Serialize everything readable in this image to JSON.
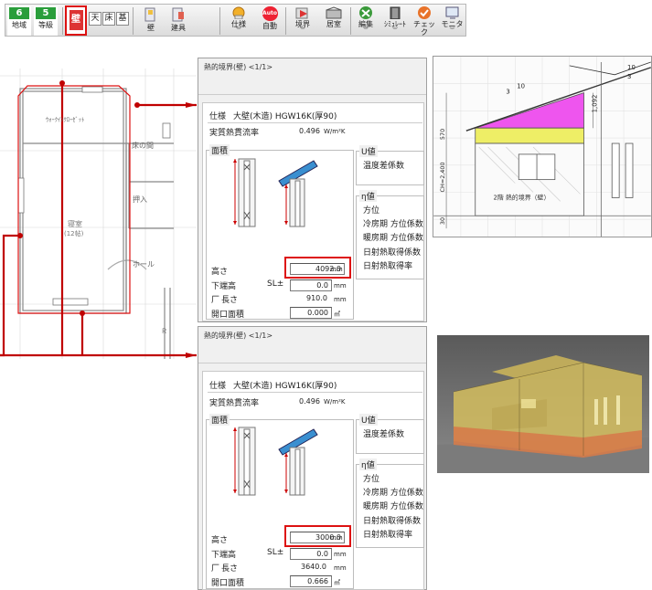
{
  "toolbar": {
    "chiiki": {
      "num": "6",
      "label": "地域"
    },
    "toukyu": {
      "num": "5",
      "label": "等級"
    },
    "kabe_active": "壁",
    "kind_buttons": [
      "天",
      "床",
      "基"
    ],
    "wall_label": "壁",
    "fitting_label": "建具",
    "spec_label": "仕様",
    "auto_icon_text": "Auto",
    "auto_label": "自動",
    "boundary_label": "境界",
    "room_label": "居室",
    "edit_label": "編集",
    "simulate_label": "ｼﾐｭﾚｰﾄ",
    "check_label": "チェック",
    "monitor_label": "モニタ"
  },
  "plan": {
    "walkin_closet": "ｳｫｰｸｲﾝｸﾛｰｾﾞｯﾄ",
    "toko": "床の間",
    "oshiire": "押入",
    "bedroom": "寝室",
    "bedroom_size": "(12帖)",
    "hall": "ホール",
    "stair_mark": "Ｒ"
  },
  "dialog1": {
    "title": "熱的境界(壁)",
    "page": "<1/1>",
    "spec_label": "仕様",
    "spec_value": "大壁(木造) HGW16K(厚90)",
    "flux_label": "実質熱貫流率",
    "flux_value": "0.496",
    "flux_unit": "W/m²K",
    "area_group": "面積",
    "height_label": "高さ",
    "height_value": "4092.0",
    "height_unit": "mm",
    "lower_label": "下端高",
    "lower_prefix": "SL±",
    "lower_value": "0.0",
    "lower_unit": "mm",
    "length_check": "厂",
    "length_label": "長さ",
    "length_value": "910.0",
    "length_unit": "mm",
    "opening_label": "開口面積",
    "opening_value": "0.000",
    "opening_unit": "㎡",
    "u_group": "U値",
    "temp_coef": "温度差係数",
    "eta_group": "η値",
    "direction": "方位",
    "cool_dir": "冷房期 方位係数",
    "heat_dir": "暖房期 方位係数",
    "solar_coef": "日射熱取得係数",
    "solar_rate": "日射熱取得率"
  },
  "dialog2": {
    "title": "熱的境界(壁)",
    "page": "<1/1>",
    "spec_label": "仕様",
    "spec_value": "大壁(木造) HGW16K(厚90)",
    "flux_label": "実質熱貫流率",
    "flux_value": "0.496",
    "flux_unit": "W/m²K",
    "area_group": "面積",
    "height_label": "高さ",
    "height_value": "3000.0",
    "height_unit": "mm",
    "lower_label": "下端高",
    "lower_prefix": "SL±",
    "lower_value": "0.0",
    "lower_unit": "mm",
    "length_check": "厂",
    "length_label": "長さ",
    "length_value": "3640.0",
    "length_unit": "mm",
    "opening_label": "開口面積",
    "opening_value": "0.666",
    "opening_unit": "㎡",
    "u_group": "U値",
    "temp_coef": "温度差係数",
    "eta_group": "η値",
    "direction": "方位",
    "cool_dir": "冷房期 方位係数",
    "heat_dir": "暖房期 方位係数",
    "solar_coef": "日射熱取得係数",
    "solar_rate": "日射熱取得率"
  },
  "elevation": {
    "slope1_num": "10",
    "slope1_den": "3",
    "slope2_num": "10",
    "slope2_den": "3",
    "dim_top": "1,092",
    "dim_570": "570",
    "dim_ch": "CH=2,400",
    "dim_30": "30",
    "caption": "2階 熱的境界（壁）"
  },
  "colors": {
    "active_red": "#d11111",
    "toolbar_green": "#2a9e3b",
    "magenta": "#ee55ee",
    "yellow": "#eeee66"
  }
}
